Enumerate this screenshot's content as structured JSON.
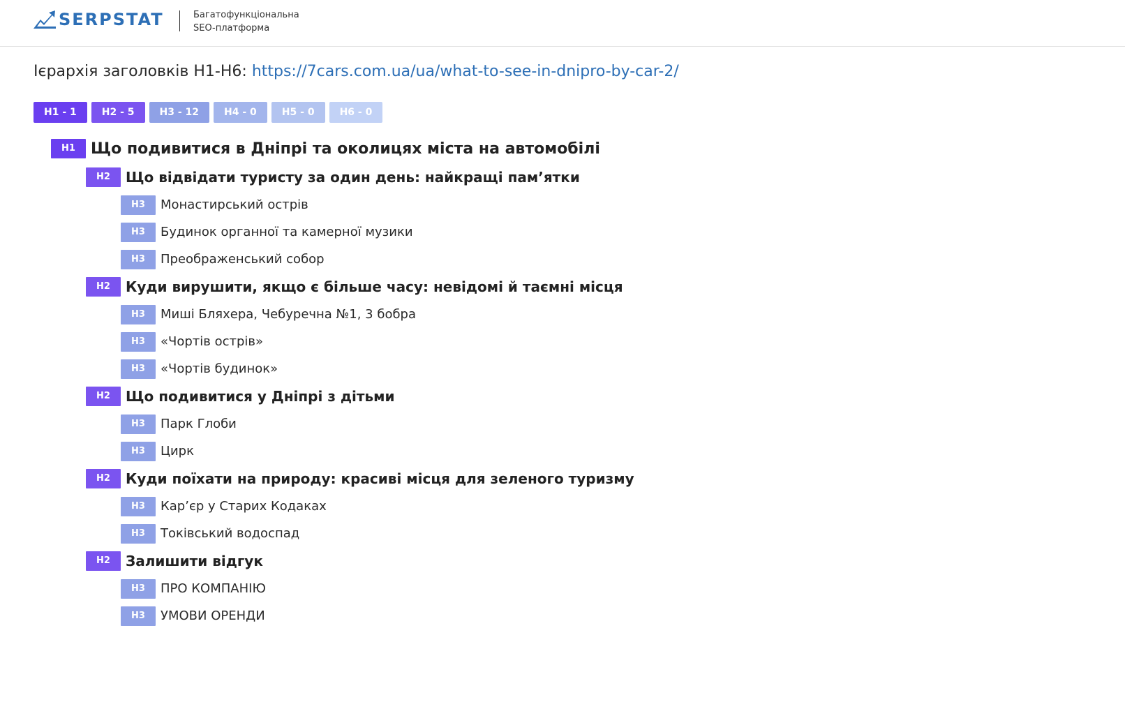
{
  "brand": {
    "name": "SERPSTAT",
    "tagline_line1": "Багатофункціональна",
    "tagline_line2": "SEO-платформа",
    "logo_icon": "serpstat-logo-icon",
    "color": "#2d6fb6"
  },
  "report": {
    "title_prefix": "Ієрархія заголовків H1-H6:",
    "url": "https://7cars.com.ua/ua/what-to-see-in-dnipro-by-car-2/"
  },
  "colors": {
    "H1": "#6a3ff0",
    "H2": "#7b54f0",
    "H3": "#8fa1e6",
    "H4": "#a3b5ec",
    "H5": "#b3c4f0",
    "H6": "#c2d2f6"
  },
  "counts": [
    {
      "label": "H1 - 1",
      "level": "H1",
      "value": 1
    },
    {
      "label": "H2 - 5",
      "level": "H2",
      "value": 5
    },
    {
      "label": "H3 - 12",
      "level": "H3",
      "value": 12
    },
    {
      "label": "H4 - 0",
      "level": "H4",
      "value": 0
    },
    {
      "label": "H5 - 0",
      "level": "H5",
      "value": 0
    },
    {
      "label": "H6 - 0",
      "level": "H6",
      "value": 0
    }
  ],
  "headings": [
    {
      "level": "H1",
      "text": "Що подивитися в Дніпрі та околицях міста на автомобілі"
    },
    {
      "level": "H2",
      "text": "Що відвідати туристу за один день: найкращі пам’ятки"
    },
    {
      "level": "H3",
      "text": "Монастирський острів"
    },
    {
      "level": "H3",
      "text": "Будинок органної та камерної музики"
    },
    {
      "level": "H3",
      "text": "Преображенський собор"
    },
    {
      "level": "H2",
      "text": "Куди вирушити, якщо є більше часу: невідомі й таємні місця"
    },
    {
      "level": "H3",
      "text": "Миші Бляхера, Чебуречна №1, 3 бобра"
    },
    {
      "level": "H3",
      "text": "«Чортів острів»"
    },
    {
      "level": "H3",
      "text": "«Чортів будинок»"
    },
    {
      "level": "H2",
      "text": "Що подивитися у Дніпрі з дітьми"
    },
    {
      "level": "H3",
      "text": "Парк Глоби"
    },
    {
      "level": "H3",
      "text": "Цирк"
    },
    {
      "level": "H2",
      "text": "Куди поїхати на природу: красиві місця для зеленого туризму"
    },
    {
      "level": "H3",
      "text": "Кар’єр у Старих Кодаках"
    },
    {
      "level": "H3",
      "text": "Токівський водоспад"
    },
    {
      "level": "H2",
      "text": "Залишити відгук"
    },
    {
      "level": "H3",
      "text": "ПРО КОМПАНІЮ"
    },
    {
      "level": "H3",
      "text": "УМОВИ ОРЕНДИ"
    }
  ]
}
